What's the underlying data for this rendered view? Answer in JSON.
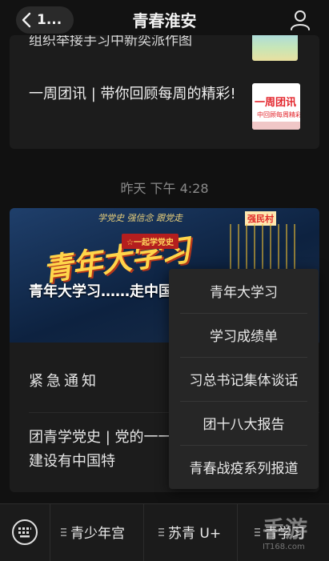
{
  "nav": {
    "back_badge": "1...",
    "title": "青春淮安"
  },
  "messages": {
    "cut_title": "组织举接手习中新奕派作图",
    "article_title": "一周团讯 | 带你回顾每周的精彩!",
    "thumb_label": "一周团讯",
    "thumb_sub": "中回顾每周精彩",
    "timestamp": "昨天 下午 4:28",
    "cover_calligraphy": "学党史 强信念 跟党走",
    "cover_badge": "☆一起学党史",
    "cover_big": "青年大学习",
    "cover_tag": "强民村",
    "cover_title": "青年大学习……走中国特色社会主义阔步",
    "urgent_notice": "紧急通知",
    "history_item": "团青学党史 | 党的一一把建设有中国特"
  },
  "popup_menu": {
    "items": [
      "青年大学习",
      "学习成绩单",
      "习总书记集体谈话",
      "团十八大报告",
      "青春战疫系列报道"
    ]
  },
  "bottom_bar": {
    "tabs": [
      "青少年宫",
      "苏青 U+",
      "青学习"
    ]
  },
  "watermark": {
    "logo": "手游",
    "url": "IT168.com"
  }
}
